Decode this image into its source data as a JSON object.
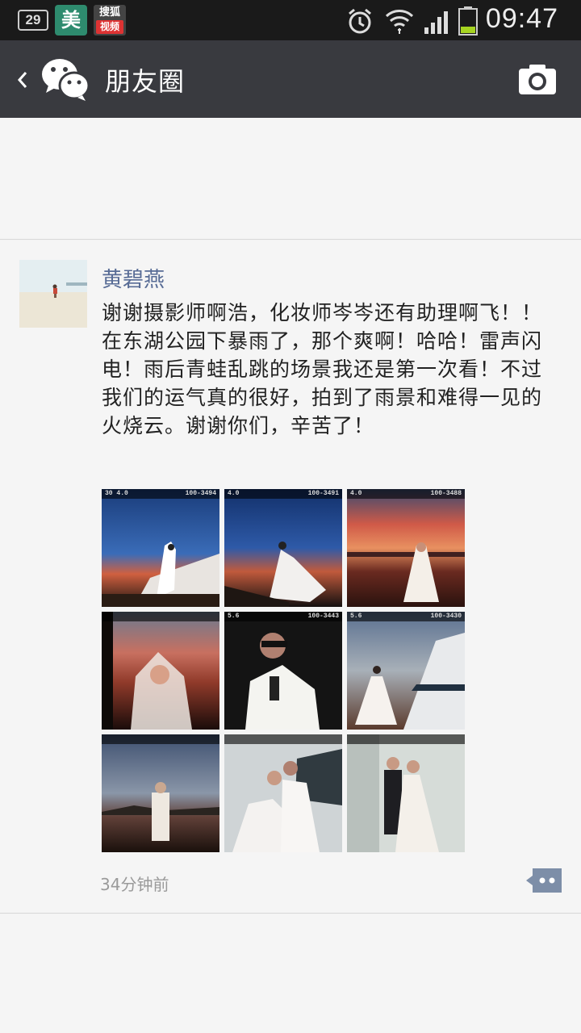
{
  "status_bar": {
    "badge_number": "29",
    "app_mei": "美",
    "app_sohu_top": "搜狐",
    "app_sohu_bottom": "视频",
    "time": "09:47"
  },
  "header": {
    "title": "朋友圈",
    "back_icon": "chevron-left-icon",
    "camera_icon": "camera-icon",
    "bg_color": "#393a3f"
  },
  "post": {
    "author": "黄碧燕",
    "author_color": "#576b95",
    "text": "谢谢摄影师啊浩，化妆师岑岑还有助理啊飞！！在东湖公园下暴雨了，那个爽啊！哈哈！雷声闪电！雨后青蛙乱跳的场景我还是第一次看！不过我们的运气真的很好，拍到了雨景和难得一见的火烧云。谢谢你们，辛苦了！",
    "time_ago": "34分钟前",
    "photos": [
      {
        "label_left": "30   4.0",
        "label_right": "100-3494"
      },
      {
        "label_left": "4.0",
        "label_right": "100-3491"
      },
      {
        "label_left": "4.0",
        "label_right": "100-3488"
      },
      {
        "label_left": "",
        "label_right": ""
      },
      {
        "label_left": "5.6",
        "label_right": "100-3443"
      },
      {
        "label_left": "5.6",
        "label_right": "100-3430"
      },
      {
        "label_left": "",
        "label_right": ""
      },
      {
        "label_left": "",
        "label_right": ""
      },
      {
        "label_left": "",
        "label_right": ""
      }
    ]
  }
}
